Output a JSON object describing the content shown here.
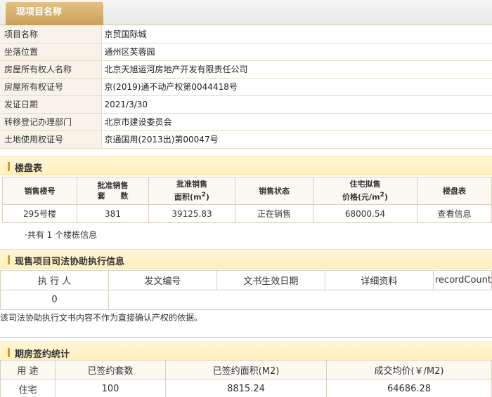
{
  "header": {
    "tab_title": "现项目名称"
  },
  "info": [
    {
      "label": "项目名称",
      "value": "京贸国际城"
    },
    {
      "label": "坐落位置",
      "value": "通州区芙蓉园"
    },
    {
      "label": "房屋所有权人名称",
      "value": "北京天旭运河房地产开发有限责任公司"
    },
    {
      "label": "房屋所有权证号",
      "value": "京(2019)通不动产权第0044418号"
    },
    {
      "label": "发证日期",
      "value": "2021/3/30"
    },
    {
      "label": "转移登记办理部门",
      "value": "北京市建设委员会"
    },
    {
      "label": "土地使用权证号",
      "value": "京通国用(2013出)第00047号"
    }
  ],
  "buildings": {
    "section_title": "楼盘表",
    "headers": {
      "building": "销售楼号",
      "sets_line1": "批准销售",
      "sets_line2": "套　　数",
      "area_line1": "批准销售",
      "area_line2": "面积(m",
      "area_sup": "2",
      "area_end": ")",
      "status": "销售状态",
      "price_line1": "住宅拟售",
      "price_line2": "价格(元/m",
      "price_sup": "2",
      "price_end": ")",
      "table": "楼盘表"
    },
    "rows": [
      {
        "building": "295号楼",
        "sets": "381",
        "area": "39125.83",
        "status": "正在销售",
        "price": "68000.54",
        "action": "查看信息"
      }
    ],
    "summary": "·共有 1 个楼栋信息"
  },
  "judicial": {
    "section_title": "现售项目司法协助执行信息",
    "headers": [
      "执 行 人",
      "发文编号",
      "文书生效日期",
      "详细资料",
      "recordCount"
    ],
    "count": "0",
    "notice": "该司法协助执行文书内容不作为直接确认产权的依据。"
  },
  "contract": {
    "section_title": "期房签约统计",
    "headers": [
      "用 途",
      "已签约套数",
      "已签约面积(M2)",
      "成交均价(￥/M2)"
    ],
    "rows": [
      {
        "use": "住宅",
        "sets": "100",
        "area": "8815.24",
        "price": "64686.28"
      }
    ]
  }
}
